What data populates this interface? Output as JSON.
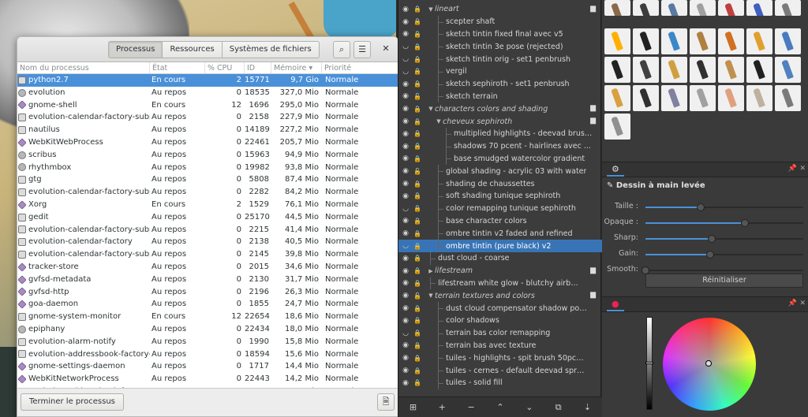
{
  "monitor": {
    "tabs": [
      "Processus",
      "Ressources",
      "Systèmes de fichiers"
    ],
    "active_tab": 0,
    "columns": {
      "name": "Nom du processus",
      "state": "État",
      "cpu": "% CPU",
      "id": "ID",
      "memory": "Mémoire",
      "priority": "Priorité"
    },
    "sort_indicator": "▾",
    "search_icon": "⌕",
    "menu_icon": "☰",
    "close_icon": "✕",
    "end_process_label": "Terminer le processus",
    "properties_icon": "🗎",
    "rows": [
      {
        "name": "python2.7",
        "state": "En cours",
        "cpu": "2",
        "id": "15771",
        "mem": "9,7 Gio",
        "prio": "Normale",
        "icon": "doc",
        "selected": true
      },
      {
        "name": "evolution",
        "state": "Au repos",
        "cpu": "0",
        "id": "18535",
        "mem": "327,0 Mio",
        "prio": "Normale",
        "icon": "gear"
      },
      {
        "name": "gnome-shell",
        "state": "En cours",
        "cpu": "12",
        "id": "1696",
        "mem": "295,0 Mio",
        "prio": "Normale",
        "icon": "diamond"
      },
      {
        "name": "evolution-calendar-factory-subprocess",
        "state": "Au repos",
        "cpu": "0",
        "id": "2158",
        "mem": "227,9 Mio",
        "prio": "Normale",
        "icon": "doc"
      },
      {
        "name": "nautilus",
        "state": "Au repos",
        "cpu": "0",
        "id": "14189",
        "mem": "227,2 Mio",
        "prio": "Normale",
        "icon": "doc"
      },
      {
        "name": "WebKitWebProcess",
        "state": "Au repos",
        "cpu": "0",
        "id": "22461",
        "mem": "205,7 Mio",
        "prio": "Normale",
        "icon": "diamond"
      },
      {
        "name": "scribus",
        "state": "Au repos",
        "cpu": "0",
        "id": "15963",
        "mem": "94,9 Mio",
        "prio": "Normale",
        "icon": "gear"
      },
      {
        "name": "rhythmbox",
        "state": "Au repos",
        "cpu": "0",
        "id": "19982",
        "mem": "93,8 Mio",
        "prio": "Normale",
        "icon": "gear"
      },
      {
        "name": "gtg",
        "state": "Au repos",
        "cpu": "0",
        "id": "5808",
        "mem": "87,4 Mio",
        "prio": "Normale",
        "icon": "doc"
      },
      {
        "name": "evolution-calendar-factory-subprocess",
        "state": "Au repos",
        "cpu": "0",
        "id": "2282",
        "mem": "84,2 Mio",
        "prio": "Normale",
        "icon": "doc"
      },
      {
        "name": "Xorg",
        "state": "En cours",
        "cpu": "2",
        "id": "1529",
        "mem": "76,1 Mio",
        "prio": "Normale",
        "icon": "diamond"
      },
      {
        "name": "gedit",
        "state": "Au repos",
        "cpu": "0",
        "id": "25170",
        "mem": "44,5 Mio",
        "prio": "Normale",
        "icon": "doc"
      },
      {
        "name": "evolution-calendar-factory-subprocess",
        "state": "Au repos",
        "cpu": "0",
        "id": "2215",
        "mem": "41,4 Mio",
        "prio": "Normale",
        "icon": "doc"
      },
      {
        "name": "evolution-calendar-factory",
        "state": "Au repos",
        "cpu": "0",
        "id": "2138",
        "mem": "40,5 Mio",
        "prio": "Normale",
        "icon": "doc"
      },
      {
        "name": "evolution-calendar-factory-subprocess",
        "state": "Au repos",
        "cpu": "0",
        "id": "2145",
        "mem": "39,8 Mio",
        "prio": "Normale",
        "icon": "doc"
      },
      {
        "name": "tracker-store",
        "state": "Au repos",
        "cpu": "0",
        "id": "2015",
        "mem": "34,6 Mio",
        "prio": "Normale",
        "icon": "diamond"
      },
      {
        "name": "gvfsd-metadata",
        "state": "Au repos",
        "cpu": "0",
        "id": "2130",
        "mem": "31,7 Mio",
        "prio": "Normale",
        "icon": "diamond"
      },
      {
        "name": "gvfsd-http",
        "state": "Au repos",
        "cpu": "0",
        "id": "2196",
        "mem": "26,3 Mio",
        "prio": "Normale",
        "icon": "diamond"
      },
      {
        "name": "goa-daemon",
        "state": "Au repos",
        "cpu": "0",
        "id": "1855",
        "mem": "24,7 Mio",
        "prio": "Normale",
        "icon": "diamond"
      },
      {
        "name": "gnome-system-monitor",
        "state": "En cours",
        "cpu": "12",
        "id": "22654",
        "mem": "18,6 Mio",
        "prio": "Normale",
        "icon": "doc"
      },
      {
        "name": "epiphany",
        "state": "Au repos",
        "cpu": "0",
        "id": "22434",
        "mem": "18,0 Mio",
        "prio": "Normale",
        "icon": "gear"
      },
      {
        "name": "evolution-alarm-notify",
        "state": "Au repos",
        "cpu": "0",
        "id": "1990",
        "mem": "15,8 Mio",
        "prio": "Normale",
        "icon": "doc"
      },
      {
        "name": "evolution-addressbook-factory-subprocess",
        "state": "Au repos",
        "cpu": "0",
        "id": "18594",
        "mem": "15,6 Mio",
        "prio": "Normale",
        "icon": "doc"
      },
      {
        "name": "gnome-settings-daemon",
        "state": "Au repos",
        "cpu": "0",
        "id": "1717",
        "mem": "14,4 Mio",
        "prio": "Normale",
        "icon": "diamond"
      },
      {
        "name": "WebKitNetworkProcess",
        "state": "Au repos",
        "cpu": "0",
        "id": "22443",
        "mem": "14,2 Mio",
        "prio": "Normale",
        "icon": "diamond"
      },
      {
        "name": "evolution-addressbook-factory-subprocess",
        "state": "Au repos",
        "cpu": "0",
        "id": "18594",
        "mem": "11,6 Mio",
        "prio": "Normale",
        "icon": "doc"
      }
    ]
  },
  "layers": {
    "rows": [
      {
        "name": "lineart",
        "group": true,
        "depth": 0,
        "expanded": true
      },
      {
        "name": "scepter shaft",
        "depth": 1
      },
      {
        "name": "sketch tintin fixed final avec v5",
        "depth": 1
      },
      {
        "name": "sketch tintin 3e pose (rejected)",
        "depth": 1,
        "hidden": true
      },
      {
        "name": "sketch tintin orig - set1 penbrush",
        "depth": 1,
        "hidden": true
      },
      {
        "name": "vergil",
        "depth": 1,
        "hidden": true
      },
      {
        "name": "sketch sephiroth - set1 penbrush",
        "depth": 1
      },
      {
        "name": "sketch terrain",
        "depth": 1,
        "unlocked": true
      },
      {
        "name": "characters colors and shading",
        "group": true,
        "depth": 0,
        "expanded": true
      },
      {
        "name": "cheveux sephiroth",
        "group": true,
        "depth": 1,
        "expanded": true
      },
      {
        "name": "multiplied highlights - deevad brush...",
        "depth": 2
      },
      {
        "name": "shadows 70 pcent - hairlines avec ...",
        "depth": 2
      },
      {
        "name": "base smudged watercolor gradient",
        "depth": 2
      },
      {
        "name": "global shading - acrylic 03 with water",
        "depth": 1,
        "unlocked": true
      },
      {
        "name": "shading de chaussettes",
        "depth": 1
      },
      {
        "name": "soft shading tunique sephiroth",
        "depth": 1
      },
      {
        "name": "color remapping tunique sephiroth",
        "depth": 1,
        "hidden": true
      },
      {
        "name": "base character colors",
        "depth": 1
      },
      {
        "name": "ombre tintin v2 faded and refined",
        "depth": 1
      },
      {
        "name": "ombre tintin (pure black) v2",
        "depth": 1,
        "hidden": true,
        "selected": true
      },
      {
        "name": "dust cloud - coarse",
        "depth": 0
      },
      {
        "name": "lifestream",
        "group": true,
        "depth": 0,
        "expanded": false
      },
      {
        "name": "lifestream white glow - blutchy airbrush 2...",
        "depth": 0
      },
      {
        "name": "terrain textures and colors",
        "group": true,
        "depth": 0,
        "expanded": true,
        "unlocked": true
      },
      {
        "name": "dust cloud compensator shadow pou...",
        "depth": 1
      },
      {
        "name": "color shadows",
        "depth": 1
      },
      {
        "name": "terrain bas color remapping",
        "depth": 1,
        "hidden": true
      },
      {
        "name": "terrain bas avec texture",
        "depth": 1
      },
      {
        "name": "tuiles - highlights - spit brush 50pcent...",
        "depth": 1
      },
      {
        "name": "tuiles - cernes - default deevad spray2",
        "depth": 1
      },
      {
        "name": "tuiles - solid fill",
        "depth": 1
      }
    ],
    "toolbar": [
      "⊞",
      "+",
      "−",
      "⌃",
      "⌄",
      "⧉",
      "⇣"
    ]
  },
  "brushes": {
    "colors": [
      "#8a6a4a",
      "#3c3c3c",
      "#5a7aa0",
      "#a0a0a0",
      "#c04040",
      "#4060c0",
      "#7a7a7a",
      "#ffb000",
      "#222222",
      "#3a88c8",
      "#b08040",
      "#d07020",
      "#e0a030",
      "#4a7ac0",
      "#222222",
      "#404040",
      "#d0a040",
      "#303030",
      "#c09050",
      "#202020",
      "#5080c0",
      "#d9a040",
      "#303030",
      "#8080a0",
      "#a0a0a0",
      "#e0a080",
      "#c0b0a0",
      "#7a7a7a",
      "#909090"
    ]
  },
  "tool_options": {
    "title": "Dessin à main levée",
    "options": [
      {
        "label": "Taille :",
        "value": 0.35
      },
      {
        "label": "Opaque :",
        "value": 0.63
      },
      {
        "label": "Sharp:",
        "value": 0.42
      },
      {
        "label": "Gain:",
        "value": 0.41
      },
      {
        "label": "Smooth:",
        "value": 0.0
      }
    ],
    "reset_label": "Réinitialiser",
    "tab_icon": "⚙",
    "pin_icon": "📌",
    "close_icon": "✕"
  },
  "color": {
    "tab_icon": "●",
    "pin_icon": "📌",
    "close_icon": "✕"
  }
}
